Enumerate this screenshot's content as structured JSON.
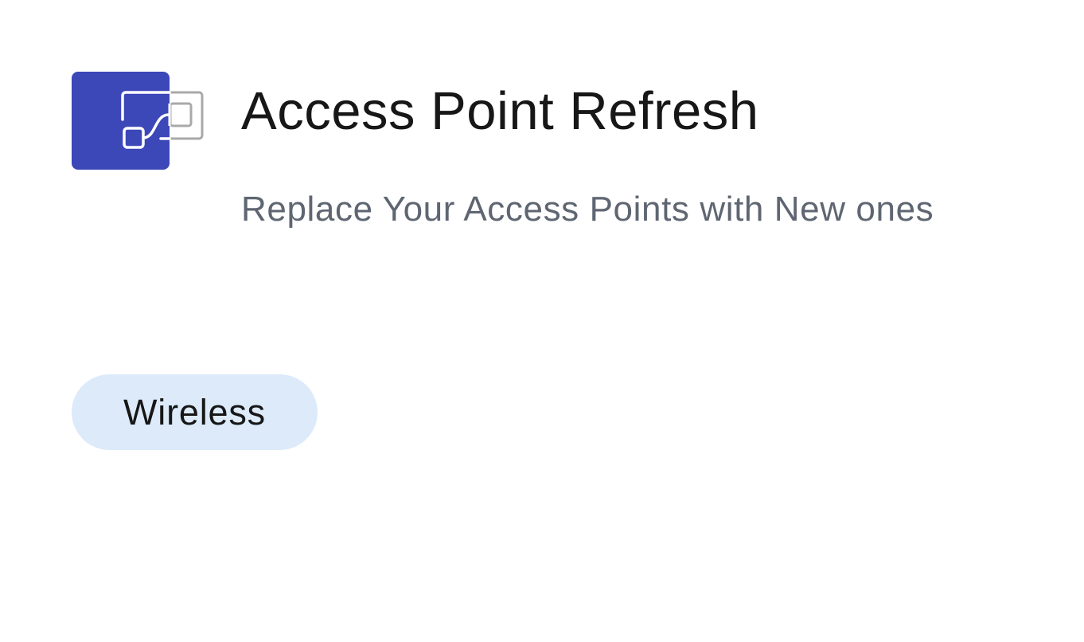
{
  "card": {
    "icon": "workflow-icon",
    "icon_color": "#3c47b8",
    "title": "Access Point Refresh",
    "description": "Replace Your Access Points with New ones",
    "tags": [
      {
        "label": "Wireless",
        "color": "#dceafa"
      }
    ]
  }
}
